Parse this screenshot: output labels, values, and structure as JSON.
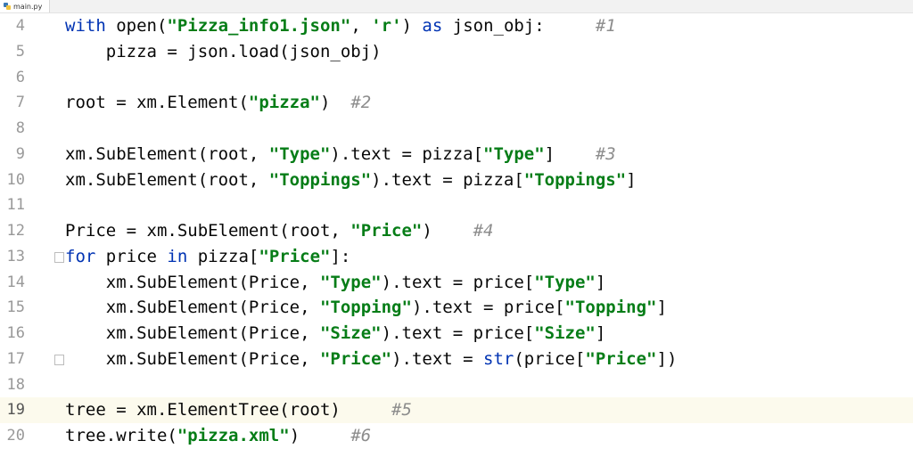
{
  "tab": {
    "filename": "main.py",
    "icon": "python-file-icon"
  },
  "editor": {
    "current_line": 19,
    "lines": [
      {
        "num": "4",
        "tokens": [
          {
            "t": "kw",
            "v": "with"
          },
          {
            "t": "p",
            "v": " open("
          },
          {
            "t": "str",
            "v": "\"Pizza_info1.json\""
          },
          {
            "t": "p",
            "v": ", "
          },
          {
            "t": "str",
            "v": "'r'"
          },
          {
            "t": "p",
            "v": ") "
          },
          {
            "t": "kw",
            "v": "as"
          },
          {
            "t": "p",
            "v": " json_obj:     "
          },
          {
            "t": "cmt",
            "v": "#1"
          }
        ]
      },
      {
        "num": "5",
        "tokens": [
          {
            "t": "p",
            "v": "    pizza = json.load(json_obj)"
          }
        ]
      },
      {
        "num": "6",
        "tokens": []
      },
      {
        "num": "7",
        "tokens": [
          {
            "t": "p",
            "v": "root = xm.Element("
          },
          {
            "t": "str",
            "v": "\"pizza\""
          },
          {
            "t": "p",
            "v": ")  "
          },
          {
            "t": "cmt",
            "v": "#2"
          }
        ]
      },
      {
        "num": "8",
        "tokens": []
      },
      {
        "num": "9",
        "tokens": [
          {
            "t": "p",
            "v": "xm.SubElement(root, "
          },
          {
            "t": "str",
            "v": "\"Type\""
          },
          {
            "t": "p",
            "v": ").text = pizza["
          },
          {
            "t": "str",
            "v": "\"Type\""
          },
          {
            "t": "p",
            "v": "]    "
          },
          {
            "t": "cmt",
            "v": "#3"
          }
        ]
      },
      {
        "num": "10",
        "tokens": [
          {
            "t": "p",
            "v": "xm.SubElement(root, "
          },
          {
            "t": "str",
            "v": "\"Toppings\""
          },
          {
            "t": "p",
            "v": ").text = pizza["
          },
          {
            "t": "str",
            "v": "\"Toppings\""
          },
          {
            "t": "p",
            "v": "]"
          }
        ]
      },
      {
        "num": "11",
        "tokens": []
      },
      {
        "num": "12",
        "tokens": [
          {
            "t": "p",
            "v": "Price = xm.SubElement(root, "
          },
          {
            "t": "str",
            "v": "\"Price\""
          },
          {
            "t": "p",
            "v": ")    "
          },
          {
            "t": "cmt",
            "v": "#4"
          }
        ]
      },
      {
        "num": "13",
        "tokens": [
          {
            "t": "kw",
            "v": "for"
          },
          {
            "t": "p",
            "v": " price "
          },
          {
            "t": "kw",
            "v": "in"
          },
          {
            "t": "p",
            "v": " pizza["
          },
          {
            "t": "str",
            "v": "\"Price\""
          },
          {
            "t": "p",
            "v": "]:"
          }
        ]
      },
      {
        "num": "14",
        "tokens": [
          {
            "t": "p",
            "v": "    xm.SubElement(Price, "
          },
          {
            "t": "str",
            "v": "\"Type\""
          },
          {
            "t": "p",
            "v": ").text = price["
          },
          {
            "t": "str",
            "v": "\"Type\""
          },
          {
            "t": "p",
            "v": "]"
          }
        ]
      },
      {
        "num": "15",
        "tokens": [
          {
            "t": "p",
            "v": "    xm.SubElement(Price, "
          },
          {
            "t": "str",
            "v": "\"Topping\""
          },
          {
            "t": "p",
            "v": ").text = price["
          },
          {
            "t": "str",
            "v": "\"Topping\""
          },
          {
            "t": "p",
            "v": "]"
          }
        ]
      },
      {
        "num": "16",
        "tokens": [
          {
            "t": "p",
            "v": "    xm.SubElement(Price, "
          },
          {
            "t": "str",
            "v": "\"Size\""
          },
          {
            "t": "p",
            "v": ").text = price["
          },
          {
            "t": "str",
            "v": "\"Size\""
          },
          {
            "t": "p",
            "v": "]"
          }
        ]
      },
      {
        "num": "17",
        "tokens": [
          {
            "t": "p",
            "v": "    xm.SubElement(Price, "
          },
          {
            "t": "str",
            "v": "\"Price\""
          },
          {
            "t": "p",
            "v": ").text = "
          },
          {
            "t": "kw",
            "v": "str"
          },
          {
            "t": "p",
            "v": "(price["
          },
          {
            "t": "str",
            "v": "\"Price\""
          },
          {
            "t": "p",
            "v": "])"
          }
        ]
      },
      {
        "num": "18",
        "tokens": []
      },
      {
        "num": "19",
        "tokens": [
          {
            "t": "p",
            "v": "tree = xm.ElementTree(root)     "
          },
          {
            "t": "cmt",
            "v": "#5"
          }
        ]
      },
      {
        "num": "20",
        "tokens": [
          {
            "t": "p",
            "v": "tree.write("
          },
          {
            "t": "str",
            "v": "\"pizza.xml\""
          },
          {
            "t": "p",
            "v": ")     "
          },
          {
            "t": "cmt",
            "v": "#6"
          }
        ]
      }
    ]
  },
  "colors": {
    "keyword": "#0033b3",
    "string": "#067d17",
    "comment": "#8c8c8c",
    "plain": "#080808",
    "line_number": "#999999",
    "current_line_bg": "#fcfaed"
  }
}
